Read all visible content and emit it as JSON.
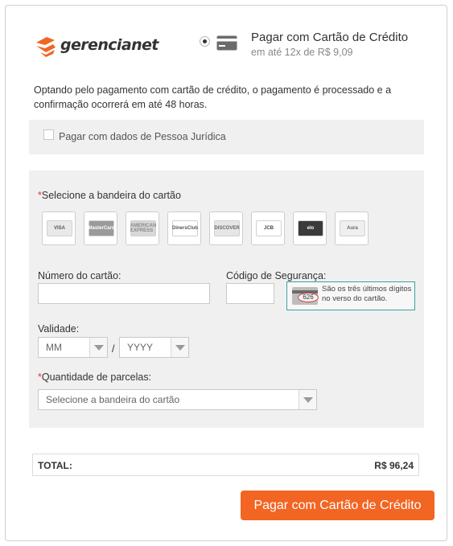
{
  "brand": {
    "logo_text": "gerencianet",
    "accent": "#f26522"
  },
  "payment_option": {
    "title": "Pagar com Cartão de Crédito",
    "subtitle": "em até 12x de R$ 9,09",
    "selected": true
  },
  "intro_text": "Optando pelo pagamento com cartão de crédito, o pagamento é processado e a confirmação ocorrerá em até 48 horas.",
  "pj_checkbox": {
    "label": "Pagar com dados de Pessoa Jurídica",
    "checked": false
  },
  "card_form": {
    "required_mark": "*",
    "brand_label": "Selecione a bandeira do cartão",
    "brands": [
      {
        "name": "VISA",
        "text": "VISA",
        "bg": "#e9e9e9",
        "color": "#555"
      },
      {
        "name": "MasterCard",
        "text": "MasterCard",
        "bg": "#9a9a9a",
        "color": "#fff"
      },
      {
        "name": "American Express",
        "text": "AMERICAN EXPRESS",
        "bg": "#d8d8d8",
        "color": "#888"
      },
      {
        "name": "Diners Club",
        "text": "DinersClub",
        "bg": "#ffffff",
        "color": "#555"
      },
      {
        "name": "Discover",
        "text": "DISCOVER",
        "bg": "#e6e6e6",
        "color": "#666"
      },
      {
        "name": "JCB",
        "text": "JCB",
        "bg": "#ffffff",
        "color": "#444"
      },
      {
        "name": "Elo",
        "text": "elo",
        "bg": "#3a3a3a",
        "color": "#fff"
      },
      {
        "name": "Aura",
        "text": "Aura",
        "bg": "#efefef",
        "color": "#666"
      }
    ],
    "card_number_label": "Número do cartão:",
    "card_number_value": "",
    "security_code_label": "Código de Segurança:",
    "security_code_value": "",
    "security_hint": "São os três últimos dígitos no verso do cartão.",
    "security_hint_sample": "626",
    "validity_label": "Validade:",
    "month_value": "MM",
    "year_value": "YYYY",
    "date_separator": "/",
    "installments_label": "Quantidade de parcelas:",
    "installments_value": "Selecione a bandeira do cartão"
  },
  "total": {
    "label": "TOTAL:",
    "value": "R$ 96,24"
  },
  "submit_label": "Pagar com Cartão de Crédito",
  "colors": {
    "required": "#e4333b",
    "hint_border": "#3aa3a6",
    "panel_bg": "#f0f0f0"
  }
}
